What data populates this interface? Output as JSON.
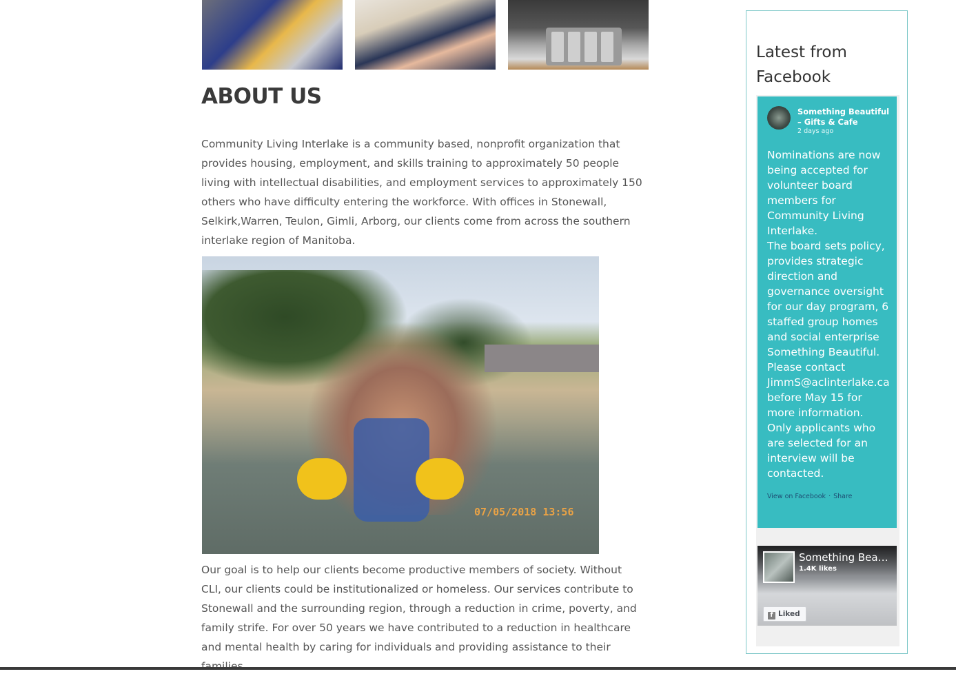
{
  "top_photos": [
    {
      "alt": "volunteers at cafe counter"
    },
    {
      "alt": "person in hockey jersey"
    },
    {
      "alt": "cutlery tray"
    }
  ],
  "about": {
    "title": "ABOUT US",
    "paragraph1": "Community Living Interlake is a community based, nonprofit organization that provides housing, employment, and skills training to approximately 50 people living with intellectual disabilities, and employment services to approximately 150 others who have difficulty entering the workforce. With offices in Stonewall, Selkirk,Warren, Teulon, Gimli, Arborg, our clients come from across the southern interlake region of Manitoba.",
    "photo_date_stamp": "07/05/2018  13:56",
    "paragraph2": "Our goal is to help our clients become productive members of society. Without CLI, our clients could be institutionalized or homeless. Our services contribute to Stonewall and the surrounding region, through a reduction in crime, poverty, and family strife. For over 50 years we have contributed to a reduction in healthcare and mental health by caring for individuals and providing assistance to their families."
  },
  "sidebar": {
    "title": "Latest from Facebook",
    "post": {
      "page_name": "Something Beautiful – Gifts & Cafe",
      "time": "2 days ago",
      "text": "Nominations are now being accepted for volunteer board members for Community Living Interlake.\nThe board sets policy, provides strategic direction and governance oversight for our day program, 6 staffed group homes and social enterprise Something Beautiful.\nPlease contact JimmS@aclinterlake.ca before May 15 for more information.\nOnly applicants who are selected for an interview will be contacted.",
      "view_link": "View on Facebook",
      "separator": "·",
      "share_link": "Share"
    },
    "page_card": {
      "name": "Something Beautiful – Gifts & Cafe",
      "likes": "1.4K likes",
      "liked_label": "Liked",
      "fb_glyph": "f"
    }
  },
  "colors": {
    "accent_teal": "#38bcc1",
    "sidebar_border": "#7cc7c8",
    "heading": "#3a3a3a",
    "body_text": "#555555"
  }
}
